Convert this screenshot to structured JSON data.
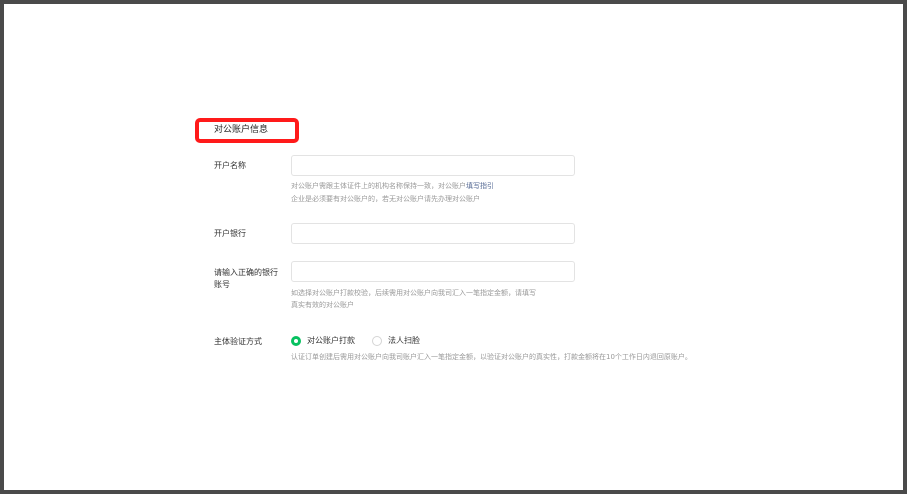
{
  "section": {
    "title": "对公账户信息"
  },
  "fields": {
    "account_name": {
      "label": "开户名称",
      "value": "",
      "hint1_prefix": "对公账户需跟主体证件上的机构名称保持一致，对公账户",
      "hint1_link": "填写指引",
      "hint2": "企业是必须要有对公账户的，若无对公账户请先办理对公账户"
    },
    "bank_name": {
      "label": "开户银行",
      "value": ""
    },
    "bank_account": {
      "label_line1": "请输入正确的银行",
      "label_line2": "账号",
      "value": "",
      "hint1": "如选择对公账户打款校验，后续需用对公账户向我司汇入一笔指定金额，请填写",
      "hint2": "真实有效的对公账户"
    },
    "verify_method": {
      "label": "主体验证方式",
      "options": [
        {
          "label": "对公账户打款",
          "checked": true
        },
        {
          "label": "法人扫脸",
          "checked": false
        }
      ],
      "hint": "认证订单创建后需用对公账户向我司账户汇入一笔指定金额，以验证对公账户的真实性，打款金额将在10个工作日内退回原账户。"
    }
  },
  "colors": {
    "accent": "#07c160",
    "highlight_box": "#ff1a1a",
    "link": "#576b95"
  }
}
